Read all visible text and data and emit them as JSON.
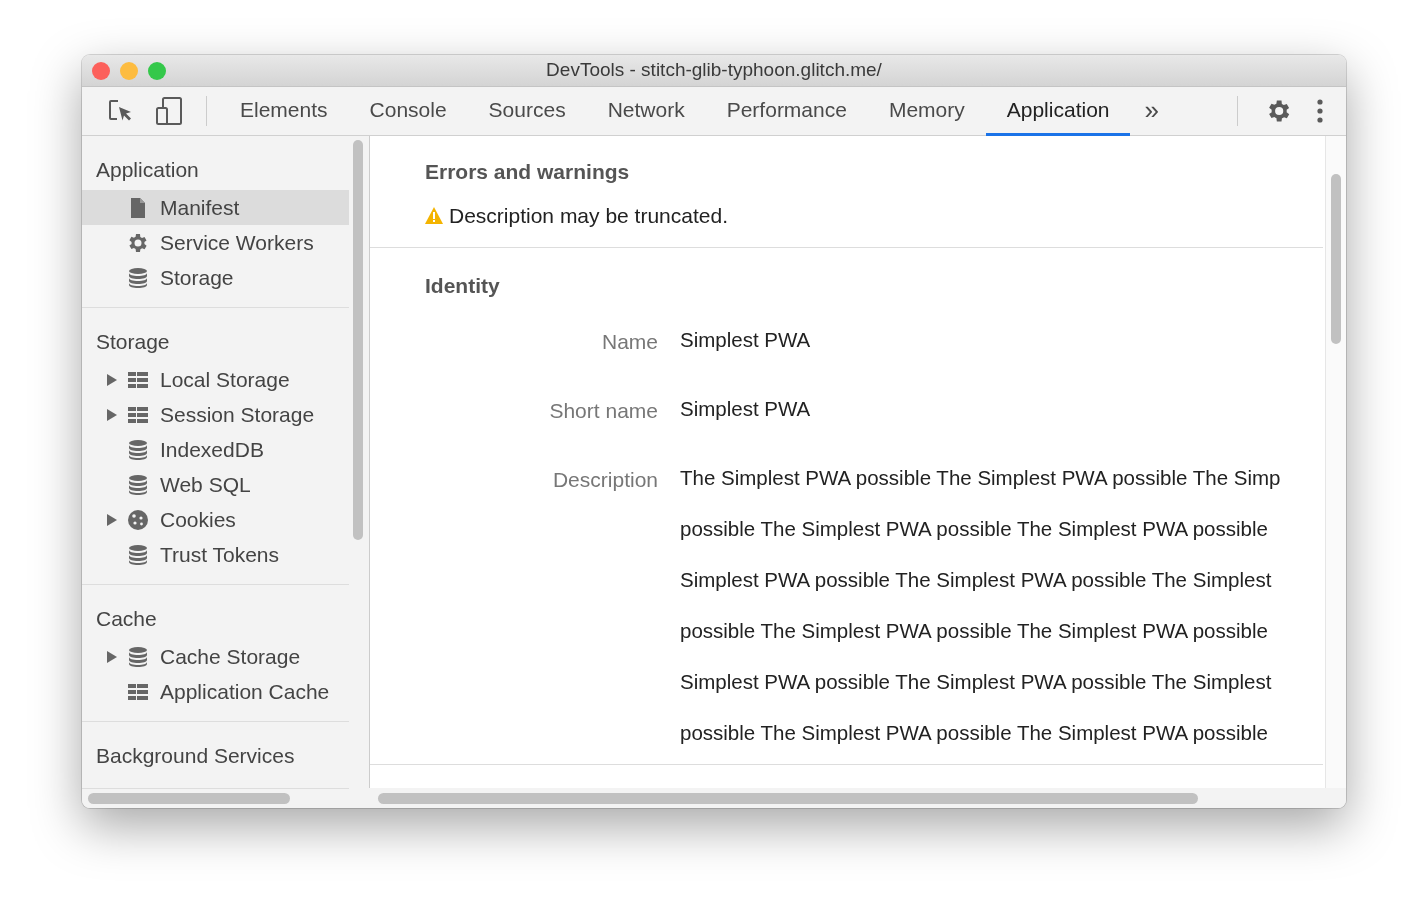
{
  "window": {
    "title": "DevTools - stitch-glib-typhoon.glitch.me/"
  },
  "toolbar": {
    "tabs": [
      {
        "label": "Elements",
        "selected": false
      },
      {
        "label": "Console",
        "selected": false
      },
      {
        "label": "Sources",
        "selected": false
      },
      {
        "label": "Network",
        "selected": false
      },
      {
        "label": "Performance",
        "selected": false
      },
      {
        "label": "Memory",
        "selected": false
      },
      {
        "label": "Application",
        "selected": true
      }
    ],
    "overflow": "»"
  },
  "sidebar": {
    "sections": [
      {
        "title": "Application",
        "items": [
          {
            "label": "Manifest",
            "kind": "file",
            "expandable": false,
            "selected": true
          },
          {
            "label": "Service Workers",
            "kind": "gear",
            "expandable": false,
            "selected": false
          },
          {
            "label": "Storage",
            "kind": "database",
            "expandable": false,
            "selected": false
          }
        ]
      },
      {
        "title": "Storage",
        "items": [
          {
            "label": "Local Storage",
            "kind": "grid",
            "expandable": true,
            "selected": false
          },
          {
            "label": "Session Storage",
            "kind": "grid",
            "expandable": true,
            "selected": false
          },
          {
            "label": "IndexedDB",
            "kind": "database",
            "expandable": false,
            "selected": false
          },
          {
            "label": "Web SQL",
            "kind": "database",
            "expandable": false,
            "selected": false
          },
          {
            "label": "Cookies",
            "kind": "cookie",
            "expandable": true,
            "selected": false
          },
          {
            "label": "Trust Tokens",
            "kind": "database",
            "expandable": false,
            "selected": false
          }
        ]
      },
      {
        "title": "Cache",
        "items": [
          {
            "label": "Cache Storage",
            "kind": "database",
            "expandable": true,
            "selected": false
          },
          {
            "label": "Application Cache",
            "kind": "grid",
            "expandable": false,
            "selected": false
          }
        ]
      },
      {
        "title": "Background Services"
      }
    ]
  },
  "errors": {
    "title": "Errors and warnings",
    "warnings": [
      "Description may be truncated."
    ]
  },
  "identity": {
    "title": "Identity",
    "fields": [
      {
        "label": "Name",
        "lines": [
          "Simplest PWA"
        ]
      },
      {
        "label": "Short name",
        "lines": [
          "Simplest PWA"
        ]
      },
      {
        "label": "Description",
        "lines": [
          "The Simplest PWA possible The Simplest PWA possible The Simp",
          "possible The Simplest PWA possible The Simplest PWA possible",
          "Simplest PWA possible The Simplest PWA possible The Simplest",
          "possible The Simplest PWA possible The Simplest PWA possible",
          "Simplest PWA possible The Simplest PWA possible The Simplest",
          "possible The Simplest PWA possible The Simplest PWA possible"
        ]
      }
    ]
  }
}
